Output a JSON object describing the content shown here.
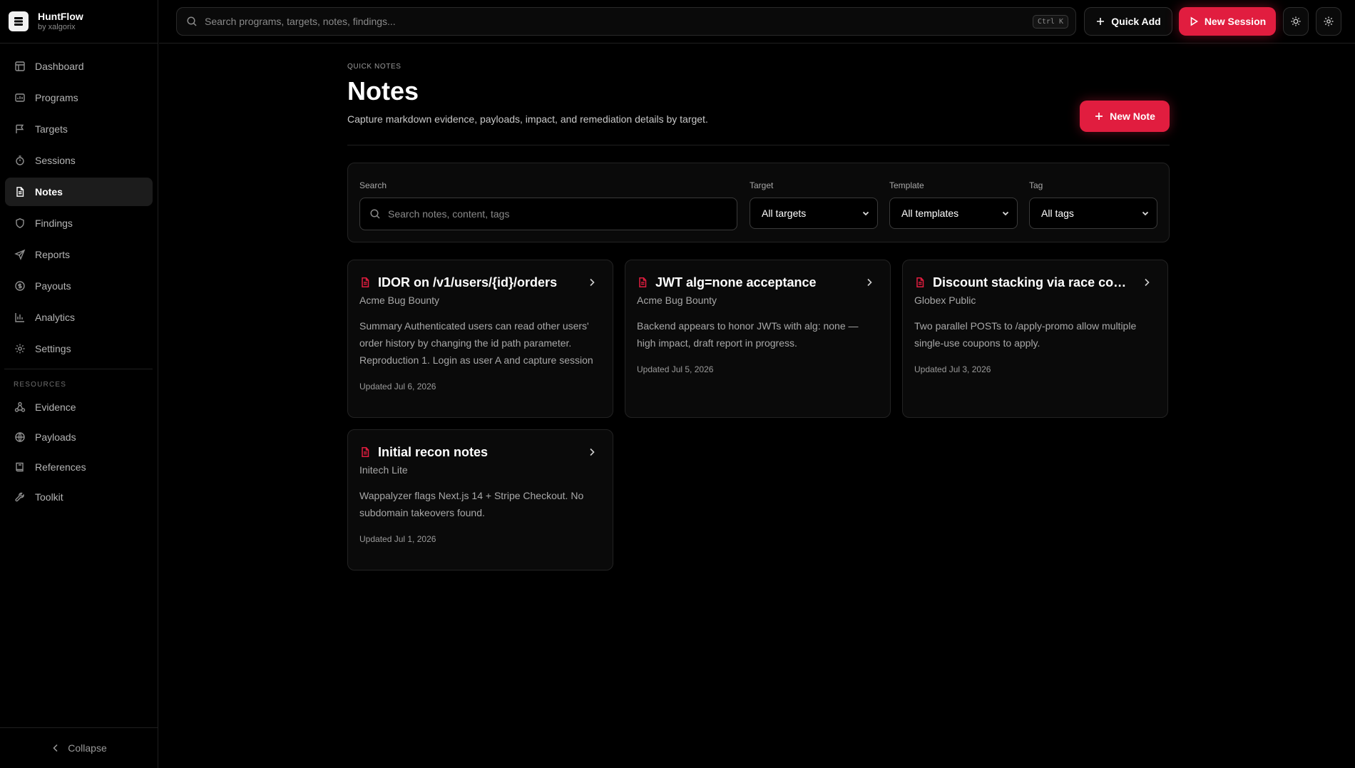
{
  "app": {
    "name": "HuntFlow",
    "by": "by xalgorix"
  },
  "nav": [
    {
      "label": "Dashboard",
      "icon": "grid-icon"
    },
    {
      "label": "Programs",
      "icon": "chart-box-icon"
    },
    {
      "label": "Targets",
      "icon": "flag-icon"
    },
    {
      "label": "Sessions",
      "icon": "timer-icon"
    },
    {
      "label": "Notes",
      "icon": "document-icon",
      "active": true
    },
    {
      "label": "Findings",
      "icon": "shield-icon"
    },
    {
      "label": "Reports",
      "icon": "send-icon"
    },
    {
      "label": "Payouts",
      "icon": "dollar-icon"
    },
    {
      "label": "Analytics",
      "icon": "bar-chart-icon"
    },
    {
      "label": "Settings",
      "icon": "gear-icon"
    }
  ],
  "resources": {
    "label": "RESOURCES",
    "items": [
      {
        "label": "Evidence",
        "icon": "nodes-icon"
      },
      {
        "label": "Payloads",
        "icon": "globe-icon"
      },
      {
        "label": "References",
        "icon": "book-icon"
      },
      {
        "label": "Toolkit",
        "icon": "wrench-icon"
      }
    ]
  },
  "collapse_label": "Collapse",
  "topbar": {
    "search_placeholder": "Search programs, targets, notes, findings...",
    "shortcut": "Ctrl K",
    "quick_add": "Quick Add",
    "new_session": "New Session"
  },
  "page": {
    "eyebrow": "QUICK NOTES",
    "title": "Notes",
    "subtitle": "Capture markdown evidence, payloads, impact, and remediation details by target.",
    "new_note": "New Note"
  },
  "filters": {
    "search_label": "Search",
    "search_placeholder": "Search notes, content, tags",
    "target_label": "Target",
    "target_value": "All targets",
    "template_label": "Template",
    "template_value": "All templates",
    "tag_label": "Tag",
    "tag_value": "All tags"
  },
  "notes": [
    {
      "title": "IDOR on /v1/users/{id}/orders",
      "program": "Acme Bug Bounty",
      "body": "Summary Authenticated users can read other users' order history by changing the id path parameter. Reproduction 1. Login as user A and capture session",
      "updated": "Updated Jul 6, 2026"
    },
    {
      "title": "JWT alg=none acceptance",
      "program": "Acme Bug Bounty",
      "body": "Backend appears to honor JWTs with alg: none — high impact, draft report in progress.",
      "updated": "Updated Jul 5, 2026"
    },
    {
      "title": "Discount stacking via race condi...",
      "program": "Globex Public",
      "body": "Two parallel POSTs to /apply-promo allow multiple single-use coupons to apply.",
      "updated": "Updated Jul 3, 2026"
    },
    {
      "title": "Initial recon notes",
      "program": "Initech Lite",
      "body": "Wappalyzer flags Next.js 14 + Stripe Checkout. No subdomain takeovers found.",
      "updated": "Updated Jul 1, 2026"
    }
  ],
  "colors": {
    "accent": "#e11d3f",
    "background": "#000000",
    "card": "#0a0a0a",
    "border": "#232323"
  }
}
